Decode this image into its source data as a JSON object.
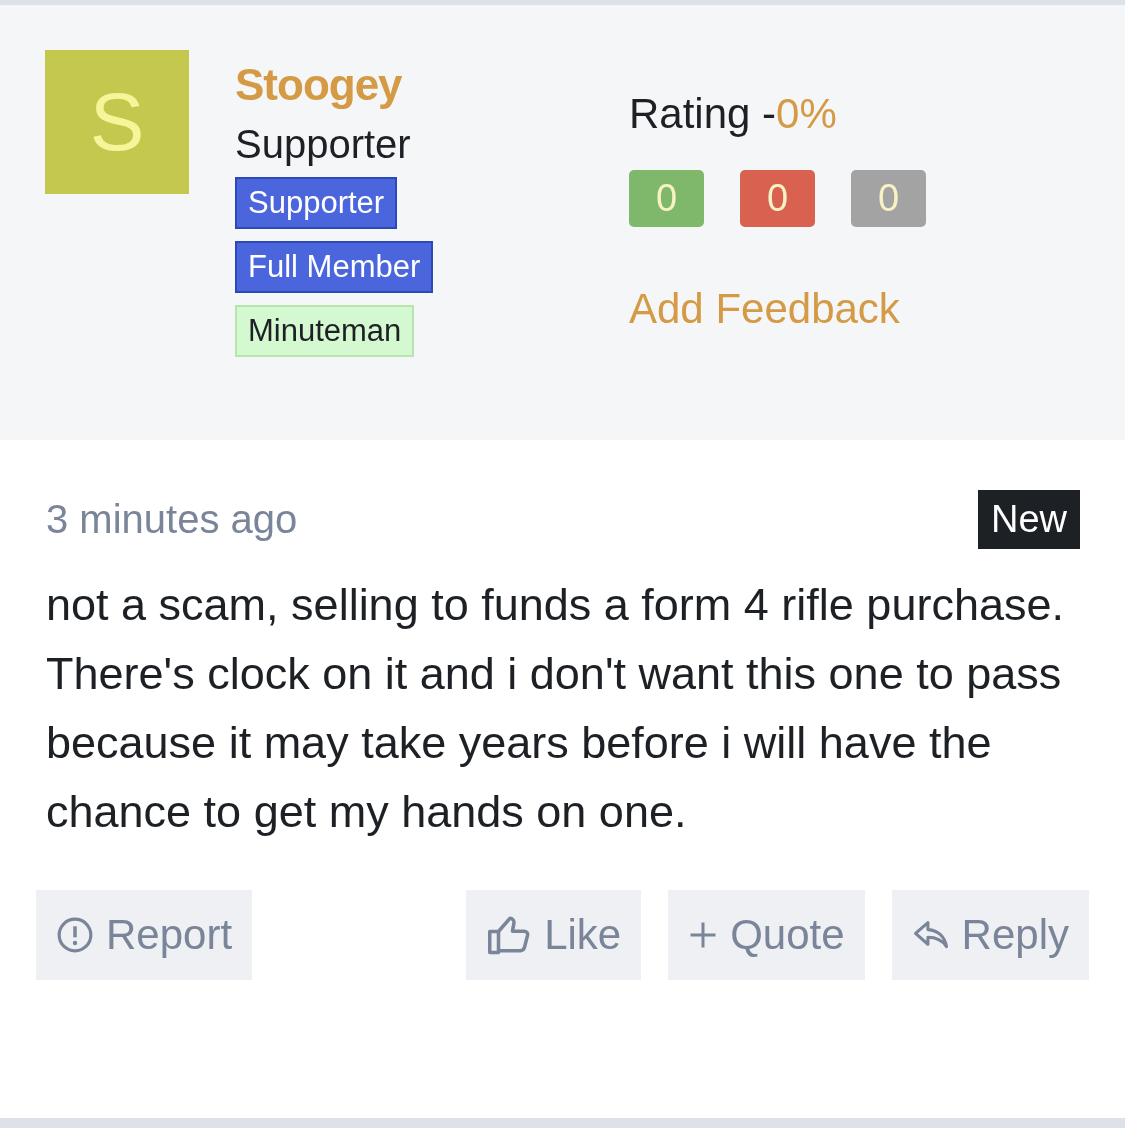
{
  "author": {
    "avatar_letter": "S",
    "name": "Stoogey",
    "title": "Supporter",
    "badges": [
      {
        "label": "Supporter",
        "kind": "blue"
      },
      {
        "label": "Full Member",
        "kind": "blue"
      },
      {
        "label": "Minuteman",
        "kind": "green"
      }
    ]
  },
  "rating": {
    "label": "Rating -",
    "value": "0%",
    "counts": [
      {
        "value": "0",
        "kind": "positive"
      },
      {
        "value": "0",
        "kind": "negative"
      },
      {
        "value": "0",
        "kind": "neutral"
      }
    ],
    "add_feedback": "Add Feedback"
  },
  "post": {
    "time": "3 minutes ago",
    "new_badge": "New",
    "text": "not a scam, selling to funds a form 4 rifle purchase. There's clock on it and i don't want this one to pass because it may take years before i will have the chance to get my hands on one."
  },
  "actions": [
    {
      "label": "Report",
      "kind": "report"
    },
    {
      "label": "Like",
      "kind": "like"
    },
    {
      "label": "Quote",
      "kind": "quote"
    },
    {
      "label": "Reply",
      "kind": "reply"
    }
  ]
}
